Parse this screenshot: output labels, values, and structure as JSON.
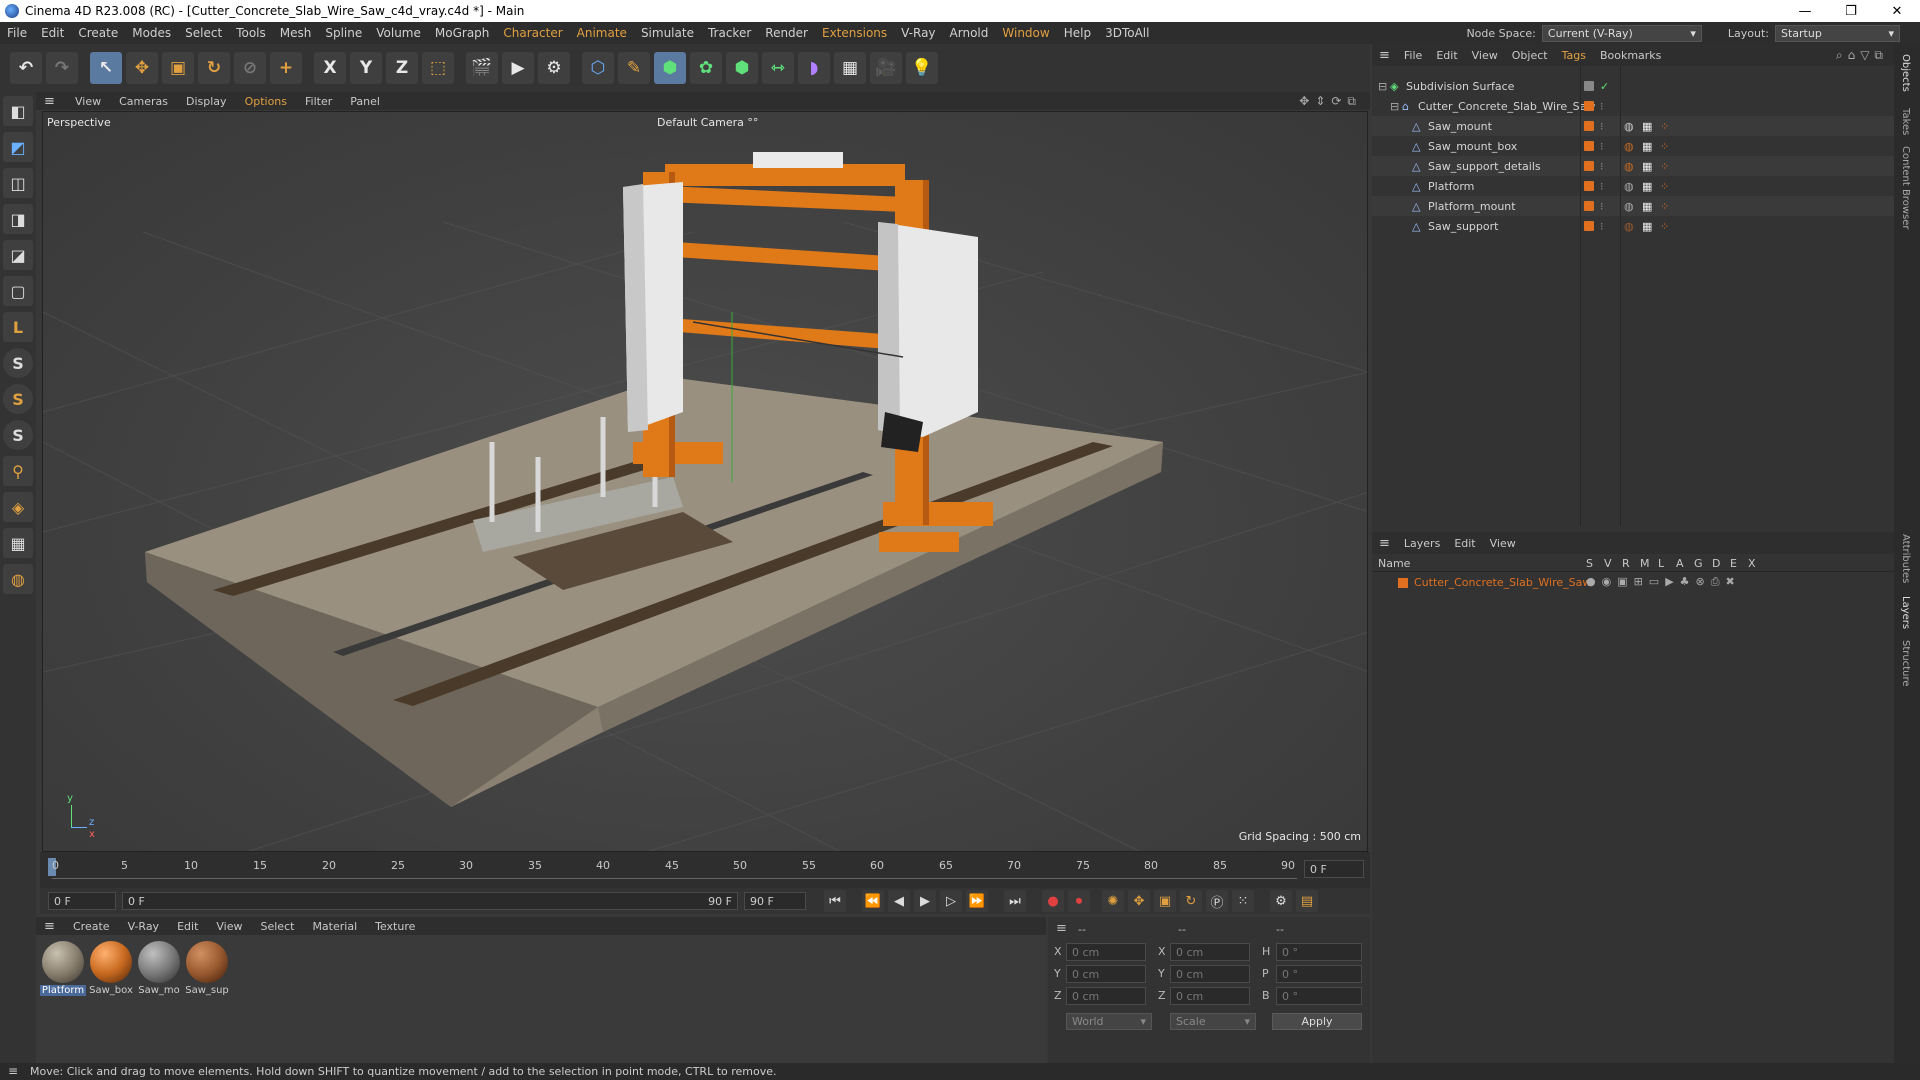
{
  "window": {
    "title": "Cinema 4D R23.008 (RC) - [Cutter_Concrete_Slab_Wire_Saw_c4d_vray.c4d *] - Main",
    "controls": [
      "—",
      "❐",
      "✕"
    ]
  },
  "menu": {
    "items": [
      "File",
      "Edit",
      "Create",
      "Modes",
      "Select",
      "Tools",
      "Mesh",
      "Spline",
      "Volume",
      "MoGraph",
      "Character",
      "Animate",
      "Simulate",
      "Tracker",
      "Render",
      "Extensions",
      "V-Ray",
      "Arnold",
      "Window",
      "Help",
      "3DToAll"
    ],
    "node_space_label": "Node Space:",
    "node_space_value": "Current (V-Ray)",
    "layout_label": "Layout:",
    "layout_value": "Startup"
  },
  "toolbar": {
    "buttons": [
      "↶",
      "↷",
      "↖",
      "✥",
      "▣",
      "↻",
      "⊘",
      "+",
      "X",
      "Y",
      "Z",
      "⬚",
      "🎬",
      "▶",
      "⚙",
      "⬡",
      "✎",
      "⬢",
      "✿",
      "⬢",
      "⇿",
      "◗",
      "▦",
      "🎥",
      "💡"
    ]
  },
  "left_tools": {
    "buttons": [
      "◧",
      "◩",
      "◫",
      "◨",
      "◪",
      "▢",
      "L",
      "S",
      "S",
      "S",
      "⚲",
      "◈",
      "▦",
      "◍"
    ]
  },
  "viewport": {
    "menu": [
      "View",
      "Cameras",
      "Display",
      "Options",
      "Filter",
      "Panel"
    ],
    "label": "Perspective",
    "camera": "Default Camera",
    "camera_suffix": "°°",
    "grid_spacing": "Grid Spacing : 500 cm",
    "axis_y": "y",
    "axis_z": "z",
    "axis_x": "x"
  },
  "timeline": {
    "ticks": [
      "0",
      "5",
      "10",
      "15",
      "20",
      "25",
      "30",
      "35",
      "40",
      "45",
      "50",
      "55",
      "60",
      "65",
      "70",
      "75",
      "80",
      "85",
      "90"
    ],
    "frame_end_field": "0 F",
    "current_frame": "0 F",
    "range_start": "0 F",
    "range_end_label": "90 F",
    "max_frame": "90 F"
  },
  "materials": {
    "menu": [
      "Create",
      "V-Ray",
      "Edit",
      "View",
      "Select",
      "Material",
      "Texture"
    ],
    "items": [
      {
        "label": "Platform",
        "color": "#8a8070"
      },
      {
        "label": "Saw_box",
        "color": "#c86a20"
      },
      {
        "label": "Saw_mo",
        "color": "#7a7a7a"
      },
      {
        "label": "Saw_sup",
        "color": "#9a5a30"
      }
    ]
  },
  "coordinates": {
    "header": [
      "--",
      "--",
      "--"
    ],
    "rows": [
      {
        "a": "X",
        "av": "0 cm",
        "b": "X",
        "bv": "0 cm",
        "c": "H",
        "cv": "0 °"
      },
      {
        "a": "Y",
        "av": "0 cm",
        "b": "Y",
        "bv": "0 cm",
        "c": "P",
        "cv": "0 °"
      },
      {
        "a": "Z",
        "av": "0 cm",
        "b": "Z",
        "bv": "0 cm",
        "c": "B",
        "cv": "0 °"
      }
    ],
    "mode": "World",
    "scale": "Scale",
    "apply": "Apply"
  },
  "objects": {
    "menu": [
      "File",
      "Edit",
      "View",
      "Object",
      "Tags",
      "Bookmarks"
    ],
    "tree": [
      {
        "name": "Subdivision Surface",
        "indent": 0
      },
      {
        "name": "Cutter_Concrete_Slab_Wire_Saw",
        "indent": 1
      },
      {
        "name": "Saw_mount",
        "indent": 2
      },
      {
        "name": "Saw_mount_box",
        "indent": 2
      },
      {
        "name": "Saw_support_details",
        "indent": 2
      },
      {
        "name": "Platform",
        "indent": 2
      },
      {
        "name": "Platform_mount",
        "indent": 2
      },
      {
        "name": "Saw_support",
        "indent": 2
      }
    ]
  },
  "layers": {
    "menu": [
      "Layers",
      "Edit",
      "View"
    ],
    "columns": [
      "Name",
      "S",
      "V",
      "R",
      "M",
      "L",
      "A",
      "G",
      "D",
      "E",
      "X"
    ],
    "items": [
      {
        "name": "Cutter_Concrete_Slab_Wire_Saw",
        "color": "#e07020"
      }
    ]
  },
  "side_tabs": [
    "Objects",
    "Takes",
    "Content Browser",
    "Attributes",
    "Layers",
    "Structure"
  ],
  "status": "Move: Click and drag to move elements. Hold down SHIFT to quantize movement / add to the selection in point mode, CTRL to remove.",
  "colors": {
    "accent": "#5a7aa0",
    "orange": "#e07020",
    "active_tab": "#e0a040"
  }
}
